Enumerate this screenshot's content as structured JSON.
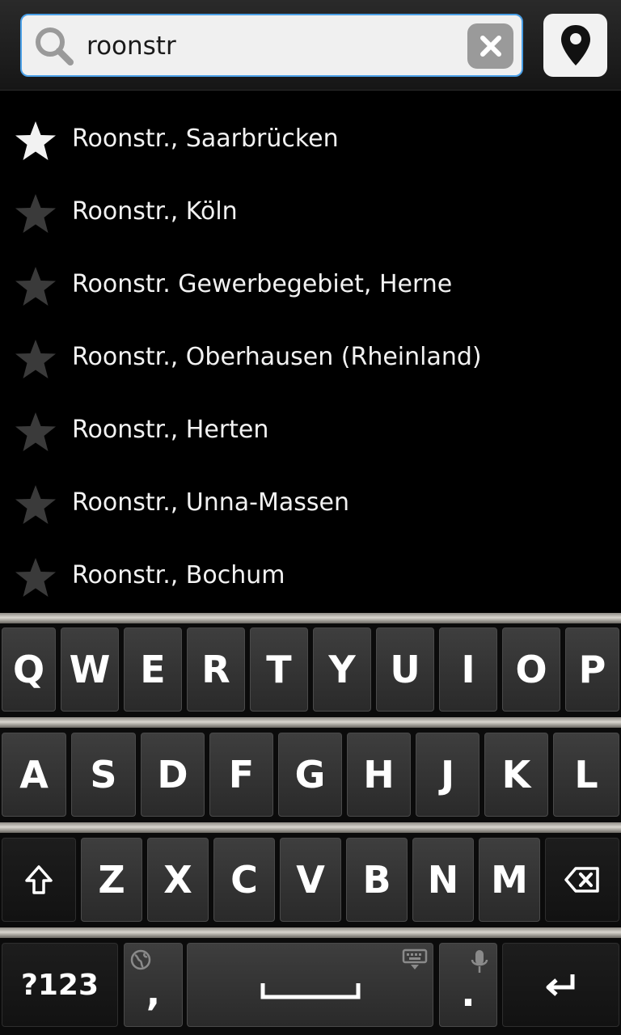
{
  "search": {
    "value": "roonstr",
    "search_icon": "search-icon",
    "clear_icon": "close-icon",
    "location_icon": "location-pin-icon"
  },
  "results": [
    {
      "label": "Roonstr., Saarbrücken",
      "favorite": true
    },
    {
      "label": "Roonstr., Köln",
      "favorite": false
    },
    {
      "label": "Roonstr. Gewerbegebiet, Herne",
      "favorite": false
    },
    {
      "label": "Roonstr., Oberhausen (Rheinland)",
      "favorite": false
    },
    {
      "label": "Roonstr., Herten",
      "favorite": false
    },
    {
      "label": "Roonstr., Unna-Massen",
      "favorite": false
    },
    {
      "label": "Roonstr., Bochum",
      "favorite": false
    }
  ],
  "keyboard": {
    "row1": [
      "Q",
      "W",
      "E",
      "R",
      "T",
      "Y",
      "U",
      "I",
      "O",
      "P"
    ],
    "row2": [
      "A",
      "S",
      "D",
      "F",
      "G",
      "H",
      "J",
      "K",
      "L"
    ],
    "row3": [
      "Z",
      "X",
      "C",
      "V",
      "B",
      "N",
      "M"
    ],
    "symbols_label": "?123",
    "comma_label": ",",
    "period_label": ".",
    "icons": {
      "shift": "shift-arrow-icon",
      "backspace": "backspace-icon",
      "language": "globe-icon",
      "hide_keyboard": "keyboard-icon",
      "voice": "microphone-icon",
      "space": "space-bar-icon",
      "enter": "enter-return-icon"
    }
  },
  "colors": {
    "accent_border": "#4a9fe6",
    "favorite_star": "#f2f2f2",
    "inactive_star": "#3a3a3a",
    "key_face": "#333333"
  }
}
